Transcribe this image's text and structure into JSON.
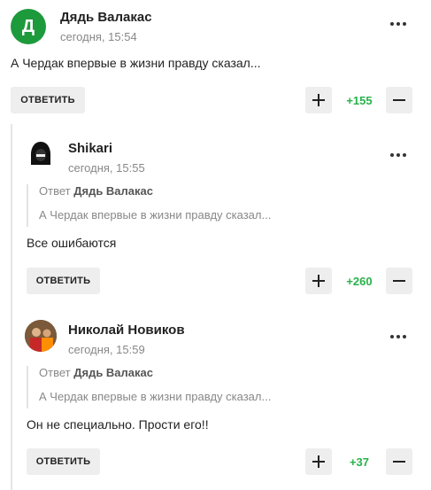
{
  "comments": [
    {
      "author": "Дядь Валакас",
      "avatar_letter": "Д",
      "avatar_color": "#1d9a3c",
      "date": "сегодня, 15:54",
      "text": "А Чердак впервые в жизни правду сказал...",
      "reply_label": "ОТВЕТИТЬ",
      "score": "+155"
    },
    {
      "author": "Shikari",
      "avatar_icon": "hooded-figure-icon",
      "date": "сегодня, 15:55",
      "quote_prefix": "Ответ",
      "quote_author": "Дядь Валакас",
      "quote_text": "А Чердак впервые в жизни правду сказал...",
      "text": "Все ошибаются",
      "reply_label": "ОТВЕТИТЬ",
      "score": "+260"
    },
    {
      "author": "Николай Новиков",
      "avatar_icon": "user-photo-icon",
      "date": "сегодня, 15:59",
      "quote_prefix": "Ответ",
      "quote_author": "Дядь Валакас",
      "quote_text": "А Чердак впервые в жизни правду сказал...",
      "text": "Он не специально. Прости его!!",
      "reply_label": "ОТВЕТИТЬ",
      "score": "+37"
    }
  ],
  "colors": {
    "score": "#27b24a",
    "button_bg": "#eeeeee",
    "accent": "#1d9a3c"
  }
}
